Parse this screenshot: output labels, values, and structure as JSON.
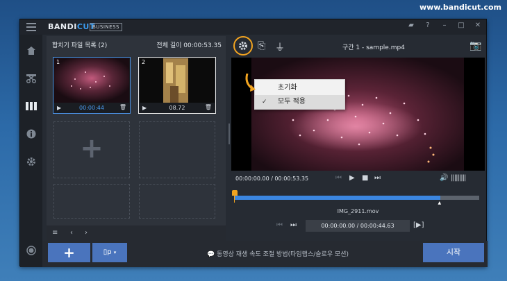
{
  "site_url": "www.bandicut.com",
  "app": {
    "logo_main": "BANDI",
    "logo_accent": "CUT",
    "edition": "BUSINESS"
  },
  "file_list": {
    "title": "합치기 파일 목록 (2)",
    "total_length": "전체 길이 00:00:53.35",
    "items": [
      {
        "num": "1",
        "duration": "00:00:44"
      },
      {
        "num": "2",
        "duration": "08.72"
      }
    ]
  },
  "segment_title": "구간 1 - sample.mp4",
  "settings_menu": {
    "items": [
      {
        "label": "초기화",
        "checked": false
      },
      {
        "label": "모두 적용",
        "checked": true
      }
    ]
  },
  "playback": {
    "time": "00:00:00.00 / 00:00:53.35",
    "progress_fraction": 0.84
  },
  "clip": {
    "name": "IMG_2911.mov",
    "time": "00:00:00.00 / 00:00:44.63"
  },
  "bottom": {
    "add_label": "+",
    "mode_label": "▯p",
    "tip": "동영상 재생 속도 조절 방법(타임랩스/슬로우 모션)",
    "start_label": "시작"
  },
  "colors": {
    "accent_orange": "#f2a420",
    "accent_blue": "#3b86e0",
    "button_blue": "#4a74bd"
  }
}
